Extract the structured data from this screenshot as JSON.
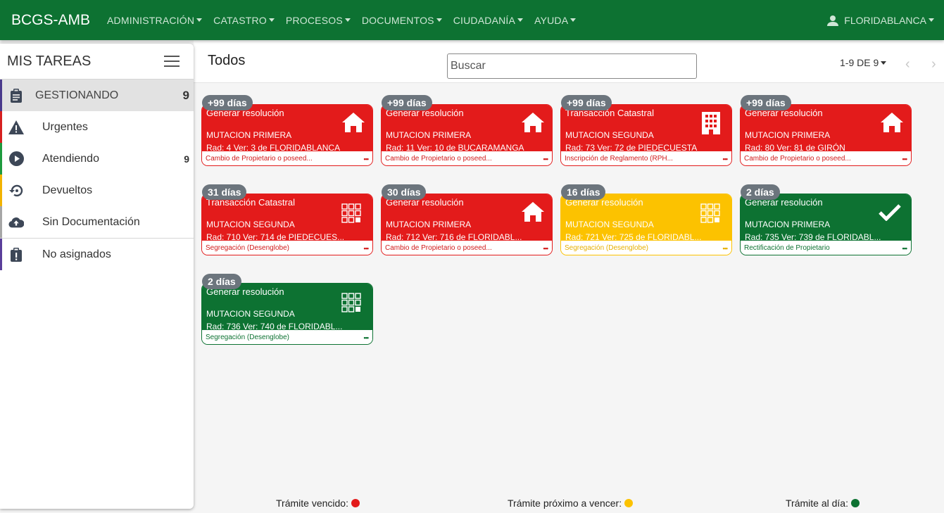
{
  "nav": {
    "brand": "BCGS-AMB",
    "menus": [
      "ADMINISTRACIÓN",
      "CATASTRO",
      "PROCESOS",
      "DOCUMENTOS",
      "CIUDADANÍA",
      "AYUDA"
    ],
    "user": "FLORIDABLANCA"
  },
  "sidebar": {
    "title": "MIS TAREAS",
    "items": [
      {
        "label": "GESTIONANDO",
        "count": "9",
        "icon": "clipboard-icon",
        "color": "#4a3a8c"
      },
      {
        "label": "Urgentes",
        "count": "",
        "icon": "warning-icon",
        "color": "#d62020"
      },
      {
        "label": "Atendiendo",
        "count": "9",
        "icon": "play-circle-icon",
        "color": "#1e9a3e"
      },
      {
        "label": "Devueltos",
        "count": "",
        "icon": "history-icon",
        "color": "#f2b300"
      },
      {
        "label": "Sin Documentación",
        "count": "",
        "icon": "cloud-upload-icon",
        "color": "#a6a6a6"
      },
      {
        "label": "No asignados",
        "count": "",
        "icon": "clipboard-alert-icon",
        "color": "#5a3e9a"
      }
    ]
  },
  "main": {
    "title": "Todos",
    "search_placeholder": "Buscar",
    "pagination": "1-9 DE 9",
    "prev_glyph": "‹",
    "next_glyph": "›"
  },
  "cards": [
    {
      "badge": "+99 días",
      "title": "Generar resolución",
      "subtitle": "MUTACION PRIMERA",
      "rad": "Rad: 4 Ver: 3 de FLORIDABLANCA",
      "footer": "Cambio de Propietario o poseed...",
      "status": "red",
      "icon": "home-icon"
    },
    {
      "badge": "+99 días",
      "title": "Generar resolución",
      "subtitle": "MUTACION PRIMERA",
      "rad": "Rad: 11 Ver: 10 de BUCARAMANGA",
      "footer": "Cambio de Propietario o poseed...",
      "status": "red",
      "icon": "home-icon"
    },
    {
      "badge": "+99 días",
      "title": "Transacción Catastral",
      "subtitle": "MUTACION SEGUNDA",
      "rad": "Rad: 73 Ver: 72 de PIEDECUESTA",
      "footer": "Inscripción de Reglamento (RPH...",
      "status": "red",
      "icon": "building-icon"
    },
    {
      "badge": "+99 días",
      "title": "Generar resolución",
      "subtitle": "MUTACION PRIMERA",
      "rad": "Rad: 80 Ver: 81 de GIRÓN",
      "footer": "Cambio de Propietario o poseed...",
      "status": "red",
      "icon": "home-icon"
    },
    {
      "badge": "31 días",
      "title": "Transacción Catastral",
      "subtitle": "MUTACION SEGUNDA",
      "rad": "Rad: 710 Ver: 714 de PIEDECUES...",
      "footer": "Segregación (Desenglobe)",
      "status": "red",
      "icon": "grid-split-icon"
    },
    {
      "badge": "30 días",
      "title": "Generar resolución",
      "subtitle": "MUTACION PRIMERA",
      "rad": "Rad: 712 Ver: 716 de FLORIDABL...",
      "footer": "Cambio de Propietario o poseed...",
      "status": "red",
      "icon": "home-icon"
    },
    {
      "badge": "16 días",
      "title": "Generar resolución",
      "subtitle": "MUTACION SEGUNDA",
      "rad": "Rad: 721 Ver: 725 de FLORIDABL...",
      "footer": "Segregación (Desenglobe)",
      "status": "yellow",
      "icon": "grid-split-icon"
    },
    {
      "badge": "2 días",
      "title": "Generar resolución",
      "subtitle": "MUTACION PRIMERA",
      "rad": "Rad: 735 Ver: 739 de FLORIDABL...",
      "footer": "Rectificación de Propietario",
      "status": "green",
      "icon": "check-icon"
    },
    {
      "badge": "2 días",
      "title": "Generar resolución",
      "subtitle": "MUTACION SEGUNDA",
      "rad": "Rad: 736 Ver: 740 de FLORIDABL...",
      "footer": "Segregación (Desenglobe)",
      "status": "green",
      "icon": "grid-split-icon"
    }
  ],
  "legend": [
    {
      "label": "Trámite vencido:",
      "color": "#e31b1b"
    },
    {
      "label": "Trámite próximo a vencer:",
      "color": "#fcc200"
    },
    {
      "label": "Trámite al día:",
      "color": "#0d7232"
    }
  ]
}
